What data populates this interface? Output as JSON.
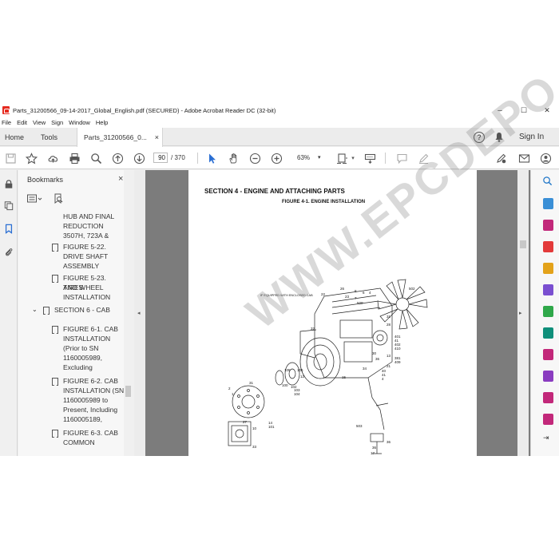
{
  "window": {
    "title": "Parts_31200566_09-14-2017_Global_English.pdf (SECURED) - Adobe Acrobat Reader DC (32-bit)",
    "minimize": "–",
    "maximize": "☐",
    "close": "✕"
  },
  "menu": [
    "File",
    "Edit",
    "View",
    "Sign",
    "Window",
    "Help"
  ],
  "tabs": {
    "home": "Home",
    "tools": "Tools",
    "document": "Parts_31200566_0...",
    "document_close": "×"
  },
  "sign_in": "Sign In",
  "help_glyph": "?",
  "toolbar": {
    "page_number": "90",
    "page_total": "/ 370",
    "zoom": "63%"
  },
  "bookmarks": {
    "title": "Bookmarks",
    "close": "×",
    "items": [
      {
        "lines": [
          "HUB AND FINAL",
          "REDUCTION",
          "3507H, 723A &"
        ],
        "level": 2,
        "flag": false
      },
      {
        "lines": [
          "FIGURE 5-22.",
          "DRIVE SHAFT",
          "ASSEMBLY"
        ],
        "level": 2,
        "flag": true
      },
      {
        "lines": [
          "FIGURE 5-23. TIRES",
          "AND WHEEL",
          "INSTALLATION"
        ],
        "level": 2,
        "flag": true
      },
      {
        "lines": [
          "SECTION 6 - CAB"
        ],
        "level": 1,
        "flag": true,
        "expanded": true
      },
      {
        "lines": [
          "FIGURE 6-1. CAB",
          "INSTALLATION",
          "(Prior to SN",
          "1160005989,",
          "Excluding"
        ],
        "level": 2,
        "flag": true
      },
      {
        "lines": [
          "FIGURE 6-2. CAB",
          "INSTALLATION (SN",
          "1160005989 to",
          "Present, Including",
          "1160005189,"
        ],
        "level": 2,
        "flag": true
      },
      {
        "lines": [
          "FIGURE 6-3. CAB",
          "COMMON"
        ],
        "level": 2,
        "flag": true
      }
    ]
  },
  "document": {
    "section_heading": "SECTION 4 - ENGINE AND ATTACHING PARTS",
    "figure_heading": "FIGURE 4-1. ENGINE INSTALLATION",
    "diagram_note": "IF EQUIPPED WITH ENCLOSED CAB",
    "watermark": "WWW.EPCDEPO.COM",
    "callouts": [
      "22",
      "26",
      "8",
      "6",
      "4",
      "502",
      "23",
      "7",
      "500",
      "31",
      "28",
      "401",
      "41",
      "402",
      "410",
      "32",
      "30",
      "13",
      "36",
      "381",
      "409",
      "34",
      "21",
      "40",
      "41",
      "4",
      "102",
      "105",
      "106",
      "12",
      "15",
      "2",
      "100",
      "103",
      "104",
      "1",
      "31",
      "27",
      "14",
      "101",
      "10",
      "33",
      "503",
      "36",
      "36",
      "17"
    ]
  },
  "colors": {
    "acrobat_red": "#e52a1f",
    "tool_blue": "#2b6fd3",
    "right_rail_icons": [
      "#1a73c7",
      "#3a8fd6",
      "#c2287a",
      "#e33a3a",
      "#e3a21a",
      "#7a4fd0",
      "#2fa84a",
      "#0f8f7a",
      "#c2287a",
      "#8a3cc0",
      "#c2287a",
      "#c2287a"
    ]
  }
}
